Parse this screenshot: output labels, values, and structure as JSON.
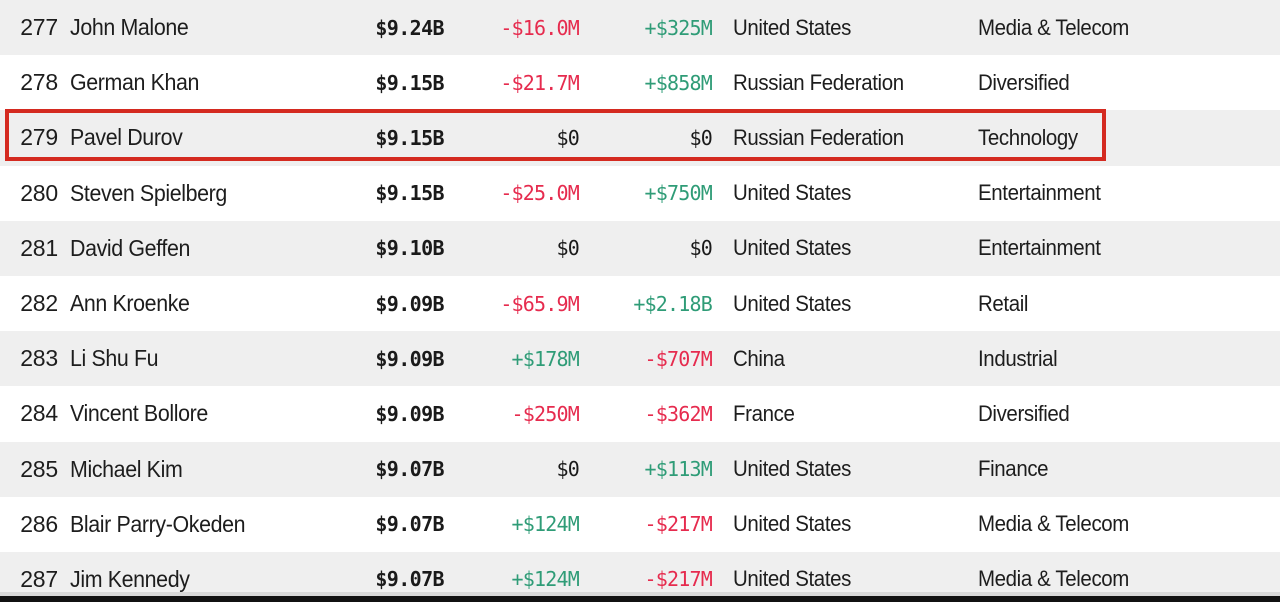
{
  "table": {
    "columns": [
      "rank",
      "name",
      "net_worth",
      "last_change",
      "ytd_change",
      "country",
      "industry"
    ],
    "highlighted_rank": "279",
    "colors": {
      "positive": "#2f9c77",
      "negative": "#e62b4e",
      "neutral": "#1a1a1a",
      "highlight_border": "#d42a20",
      "row_stripe": "#efefef",
      "row_base": "#ffffff"
    },
    "rows": [
      {
        "rank": "277",
        "name": "John Malone",
        "net_worth": "$9.24B",
        "last_change": "-$16.0M",
        "last_change_sign": "neg",
        "ytd_change": "+$325M",
        "ytd_change_sign": "pos",
        "country": "United States",
        "industry": "Media & Telecom",
        "stripe": true,
        "highlighted": false
      },
      {
        "rank": "278",
        "name": "German Khan",
        "net_worth": "$9.15B",
        "last_change": "-$21.7M",
        "last_change_sign": "neg",
        "ytd_change": "+$858M",
        "ytd_change_sign": "pos",
        "country": "Russian Federation",
        "industry": "Diversified",
        "stripe": false,
        "highlighted": false
      },
      {
        "rank": "279",
        "name": "Pavel Durov",
        "net_worth": "$9.15B",
        "last_change": "$0",
        "last_change_sign": "zero",
        "ytd_change": "$0",
        "ytd_change_sign": "zero",
        "country": "Russian Federation",
        "industry": "Technology",
        "stripe": true,
        "highlighted": true
      },
      {
        "rank": "280",
        "name": "Steven Spielberg",
        "net_worth": "$9.15B",
        "last_change": "-$25.0M",
        "last_change_sign": "neg",
        "ytd_change": "+$750M",
        "ytd_change_sign": "pos",
        "country": "United States",
        "industry": "Entertainment",
        "stripe": false,
        "highlighted": false
      },
      {
        "rank": "281",
        "name": "David Geffen",
        "net_worth": "$9.10B",
        "last_change": "$0",
        "last_change_sign": "zero",
        "ytd_change": "$0",
        "ytd_change_sign": "zero",
        "country": "United States",
        "industry": "Entertainment",
        "stripe": true,
        "highlighted": false
      },
      {
        "rank": "282",
        "name": "Ann Kroenke",
        "net_worth": "$9.09B",
        "last_change": "-$65.9M",
        "last_change_sign": "neg",
        "ytd_change": "+$2.18B",
        "ytd_change_sign": "pos",
        "country": "United States",
        "industry": "Retail",
        "stripe": false,
        "highlighted": false
      },
      {
        "rank": "283",
        "name": "Li Shu Fu",
        "net_worth": "$9.09B",
        "last_change": "+$178M",
        "last_change_sign": "pos",
        "ytd_change": "-$707M",
        "ytd_change_sign": "neg",
        "country": "China",
        "industry": "Industrial",
        "stripe": true,
        "highlighted": false
      },
      {
        "rank": "284",
        "name": "Vincent Bollore",
        "net_worth": "$9.09B",
        "last_change": "-$250M",
        "last_change_sign": "neg",
        "ytd_change": "-$362M",
        "ytd_change_sign": "neg",
        "country": "France",
        "industry": "Diversified",
        "stripe": false,
        "highlighted": false
      },
      {
        "rank": "285",
        "name": "Michael Kim",
        "net_worth": "$9.07B",
        "last_change": "$0",
        "last_change_sign": "zero",
        "ytd_change": "+$113M",
        "ytd_change_sign": "pos",
        "country": "United States",
        "industry": "Finance",
        "stripe": true,
        "highlighted": false
      },
      {
        "rank": "286",
        "name": "Blair Parry-Okeden",
        "net_worth": "$9.07B",
        "last_change": "+$124M",
        "last_change_sign": "pos",
        "ytd_change": "-$217M",
        "ytd_change_sign": "neg",
        "country": "United States",
        "industry": "Media & Telecom",
        "stripe": false,
        "highlighted": false
      },
      {
        "rank": "287",
        "name": "Jim Kennedy",
        "net_worth": "$9.07B",
        "last_change": "+$124M",
        "last_change_sign": "pos",
        "ytd_change": "-$217M",
        "ytd_change_sign": "neg",
        "country": "United States",
        "industry": "Media & Telecom",
        "stripe": true,
        "highlighted": false
      }
    ]
  }
}
